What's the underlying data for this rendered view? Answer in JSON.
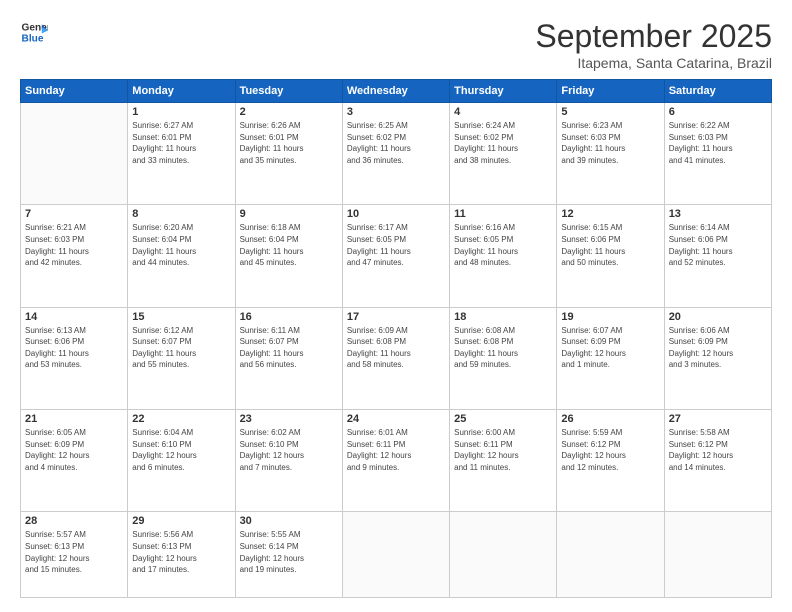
{
  "logo": {
    "line1": "General",
    "line2": "Blue"
  },
  "title": "September 2025",
  "subtitle": "Itapema, Santa Catarina, Brazil",
  "days_of_week": [
    "Sunday",
    "Monday",
    "Tuesday",
    "Wednesday",
    "Thursday",
    "Friday",
    "Saturday"
  ],
  "weeks": [
    [
      {
        "day": "",
        "info": ""
      },
      {
        "day": "1",
        "info": "Sunrise: 6:27 AM\nSunset: 6:01 PM\nDaylight: 11 hours\nand 33 minutes."
      },
      {
        "day": "2",
        "info": "Sunrise: 6:26 AM\nSunset: 6:01 PM\nDaylight: 11 hours\nand 35 minutes."
      },
      {
        "day": "3",
        "info": "Sunrise: 6:25 AM\nSunset: 6:02 PM\nDaylight: 11 hours\nand 36 minutes."
      },
      {
        "day": "4",
        "info": "Sunrise: 6:24 AM\nSunset: 6:02 PM\nDaylight: 11 hours\nand 38 minutes."
      },
      {
        "day": "5",
        "info": "Sunrise: 6:23 AM\nSunset: 6:03 PM\nDaylight: 11 hours\nand 39 minutes."
      },
      {
        "day": "6",
        "info": "Sunrise: 6:22 AM\nSunset: 6:03 PM\nDaylight: 11 hours\nand 41 minutes."
      }
    ],
    [
      {
        "day": "7",
        "info": "Sunrise: 6:21 AM\nSunset: 6:03 PM\nDaylight: 11 hours\nand 42 minutes."
      },
      {
        "day": "8",
        "info": "Sunrise: 6:20 AM\nSunset: 6:04 PM\nDaylight: 11 hours\nand 44 minutes."
      },
      {
        "day": "9",
        "info": "Sunrise: 6:18 AM\nSunset: 6:04 PM\nDaylight: 11 hours\nand 45 minutes."
      },
      {
        "day": "10",
        "info": "Sunrise: 6:17 AM\nSunset: 6:05 PM\nDaylight: 11 hours\nand 47 minutes."
      },
      {
        "day": "11",
        "info": "Sunrise: 6:16 AM\nSunset: 6:05 PM\nDaylight: 11 hours\nand 48 minutes."
      },
      {
        "day": "12",
        "info": "Sunrise: 6:15 AM\nSunset: 6:06 PM\nDaylight: 11 hours\nand 50 minutes."
      },
      {
        "day": "13",
        "info": "Sunrise: 6:14 AM\nSunset: 6:06 PM\nDaylight: 11 hours\nand 52 minutes."
      }
    ],
    [
      {
        "day": "14",
        "info": "Sunrise: 6:13 AM\nSunset: 6:06 PM\nDaylight: 11 hours\nand 53 minutes."
      },
      {
        "day": "15",
        "info": "Sunrise: 6:12 AM\nSunset: 6:07 PM\nDaylight: 11 hours\nand 55 minutes."
      },
      {
        "day": "16",
        "info": "Sunrise: 6:11 AM\nSunset: 6:07 PM\nDaylight: 11 hours\nand 56 minutes."
      },
      {
        "day": "17",
        "info": "Sunrise: 6:09 AM\nSunset: 6:08 PM\nDaylight: 11 hours\nand 58 minutes."
      },
      {
        "day": "18",
        "info": "Sunrise: 6:08 AM\nSunset: 6:08 PM\nDaylight: 11 hours\nand 59 minutes."
      },
      {
        "day": "19",
        "info": "Sunrise: 6:07 AM\nSunset: 6:09 PM\nDaylight: 12 hours\nand 1 minute."
      },
      {
        "day": "20",
        "info": "Sunrise: 6:06 AM\nSunset: 6:09 PM\nDaylight: 12 hours\nand 3 minutes."
      }
    ],
    [
      {
        "day": "21",
        "info": "Sunrise: 6:05 AM\nSunset: 6:09 PM\nDaylight: 12 hours\nand 4 minutes."
      },
      {
        "day": "22",
        "info": "Sunrise: 6:04 AM\nSunset: 6:10 PM\nDaylight: 12 hours\nand 6 minutes."
      },
      {
        "day": "23",
        "info": "Sunrise: 6:02 AM\nSunset: 6:10 PM\nDaylight: 12 hours\nand 7 minutes."
      },
      {
        "day": "24",
        "info": "Sunrise: 6:01 AM\nSunset: 6:11 PM\nDaylight: 12 hours\nand 9 minutes."
      },
      {
        "day": "25",
        "info": "Sunrise: 6:00 AM\nSunset: 6:11 PM\nDaylight: 12 hours\nand 11 minutes."
      },
      {
        "day": "26",
        "info": "Sunrise: 5:59 AM\nSunset: 6:12 PM\nDaylight: 12 hours\nand 12 minutes."
      },
      {
        "day": "27",
        "info": "Sunrise: 5:58 AM\nSunset: 6:12 PM\nDaylight: 12 hours\nand 14 minutes."
      }
    ],
    [
      {
        "day": "28",
        "info": "Sunrise: 5:57 AM\nSunset: 6:13 PM\nDaylight: 12 hours\nand 15 minutes."
      },
      {
        "day": "29",
        "info": "Sunrise: 5:56 AM\nSunset: 6:13 PM\nDaylight: 12 hours\nand 17 minutes."
      },
      {
        "day": "30",
        "info": "Sunrise: 5:55 AM\nSunset: 6:14 PM\nDaylight: 12 hours\nand 19 minutes."
      },
      {
        "day": "",
        "info": ""
      },
      {
        "day": "",
        "info": ""
      },
      {
        "day": "",
        "info": ""
      },
      {
        "day": "",
        "info": ""
      }
    ]
  ]
}
